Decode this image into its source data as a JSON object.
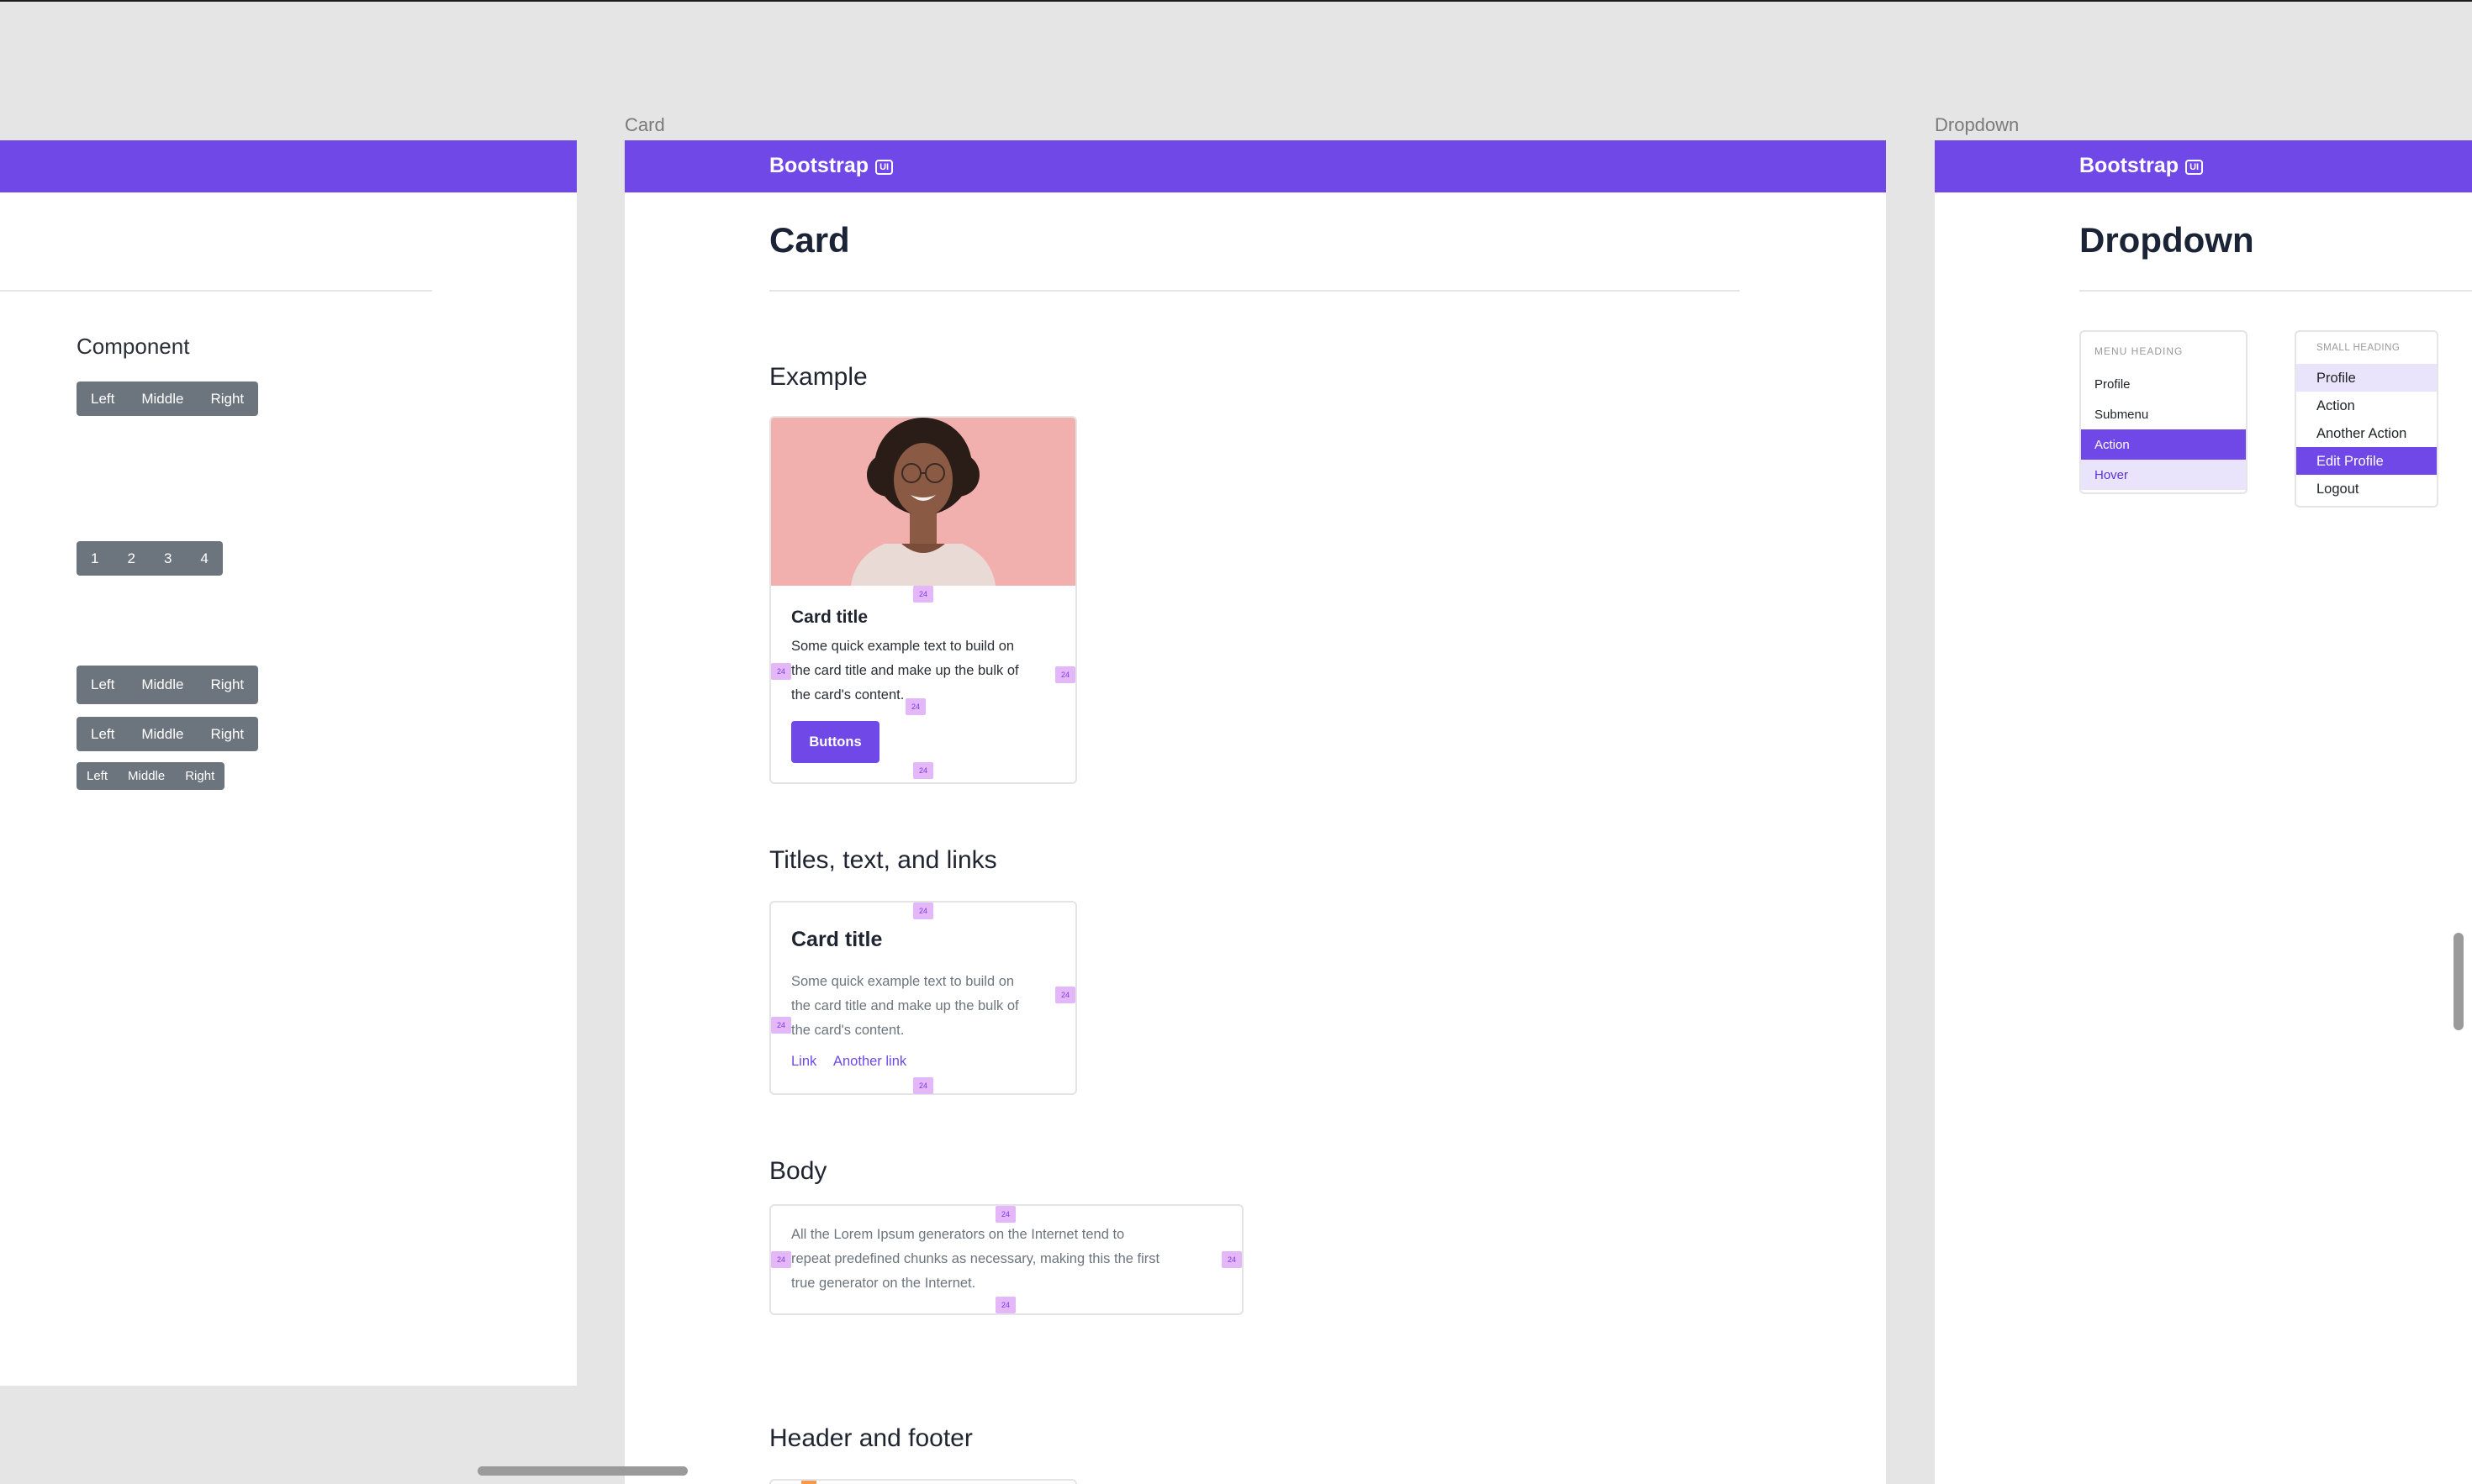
{
  "frames": {
    "card_label": "Card",
    "dropdown_label": "Dropdown"
  },
  "brand": {
    "name": "Bootstrap",
    "badge": "UI"
  },
  "left_frame": {
    "component_title": "Component",
    "group1": [
      "Left",
      "Middle",
      "Right"
    ],
    "pagination": [
      "1",
      "2",
      "3",
      "4"
    ],
    "group_lg": [
      "Left",
      "Middle",
      "Right"
    ],
    "group_md": [
      "Left",
      "Middle",
      "Right"
    ],
    "group_sm": [
      "Left",
      "Middle",
      "Right"
    ]
  },
  "card_frame": {
    "title": "Card",
    "example_title": "Example",
    "example_card": {
      "title": "Card title",
      "text_lines": [
        "Some quick example text to build on",
        "the card title and make up the bulk of",
        "the card's content."
      ],
      "button": "Buttons"
    },
    "titles_section": "Titles, text, and links",
    "titles_card": {
      "title": "Card title",
      "text_lines": [
        "Some quick example text to build on",
        "the card title and make up the bulk of",
        "the card's content."
      ],
      "link1": "Link",
      "link2": "Another link"
    },
    "body_section": "Body",
    "body_text_lines": [
      "All the Lorem Ipsum generators on the Internet tend to",
      "repeat predefined chunks as necessary, making this the first",
      "true generator on the Internet."
    ],
    "header_footer_section": "Header and footer",
    "marker_glyph": "24"
  },
  "dropdown_frame": {
    "title": "Dropdown",
    "menu1": {
      "heading": "MENU HEADING",
      "items": [
        "Profile",
        "Submenu",
        "Action",
        "Hover"
      ]
    },
    "menu2": {
      "heading": "SMALL HEADING",
      "items": [
        "Profile",
        "Action",
        "Another Action",
        "Edit Profile",
        "Logout"
      ]
    }
  },
  "colors": {
    "primary": "#7048e8",
    "secondary": "#6c757d",
    "hover_bg": "#e9e3fc",
    "marker": "#e3b7f8"
  }
}
